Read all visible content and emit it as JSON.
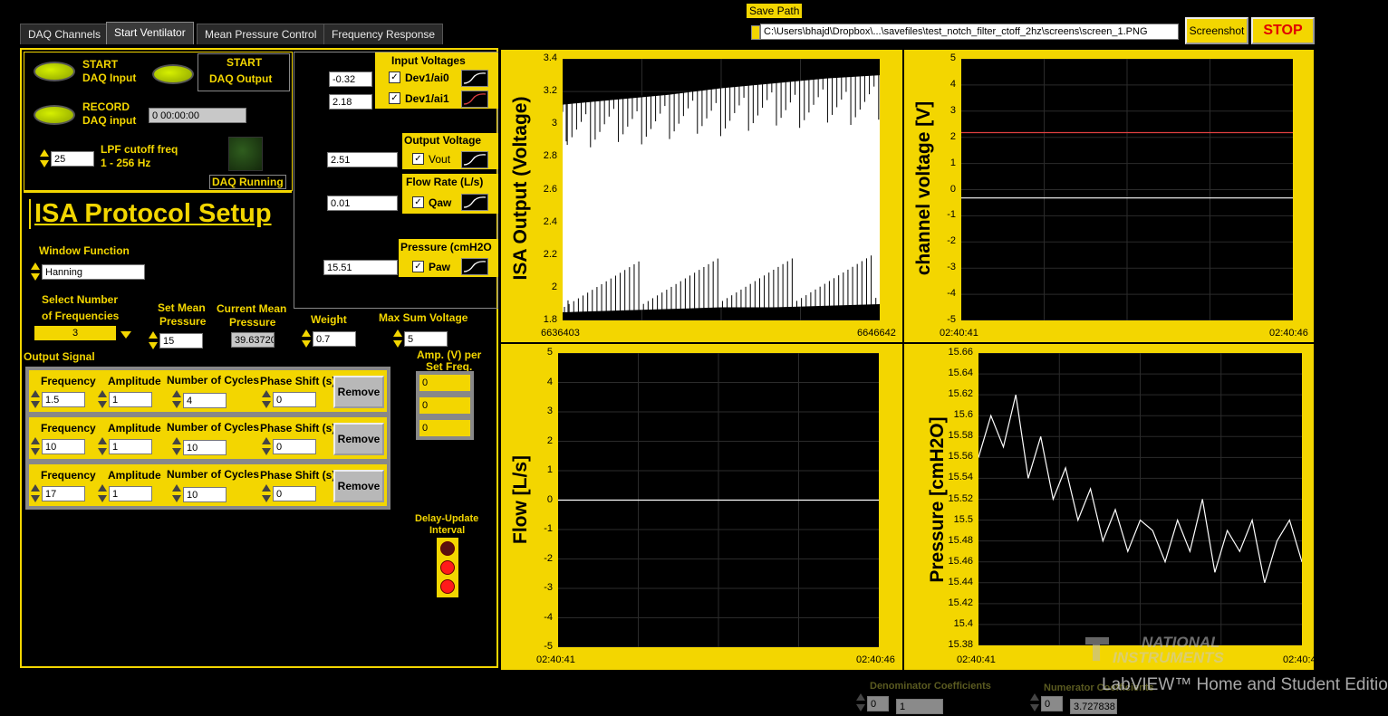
{
  "tabs": [
    "DAQ Channels",
    "Start Ventilator",
    "Mean Pressure Control",
    "Frequency Response"
  ],
  "header": {
    "save_path_label": "Save Path",
    "save_path_value": "C:\\Users\\bhajd\\Dropbox\\...\\savefiles\\test_notch_filter_ctoff_2hz\\screens\\screen_1.PNG",
    "screenshot_label": "Screenshot",
    "stop_label": "STOP"
  },
  "daq": {
    "start_input_line1": "START",
    "start_input_line2": "DAQ Input",
    "start_output_line1": "START",
    "start_output_line2": "DAQ Output",
    "record_line1": "RECORD",
    "record_line2": "DAQ input",
    "record_time": "0  00:00:00",
    "lpf_value": "25",
    "lpf_label_line1": "LPF cutoff freq",
    "lpf_label_line2": "1 - 256 Hz",
    "running_label": "DAQ Running"
  },
  "channels": {
    "input_voltages_label": "Input Voltages",
    "ai0_value": "-0.32",
    "ai0_label": "Dev1/ai0",
    "ai1_value": "2.18",
    "ai1_label": "Dev1/ai1",
    "output_voltage_label": "Output Voltage",
    "vout_value": "2.51",
    "vout_label": "Vout",
    "flow_rate_label": "Flow Rate (L/s)",
    "qaw_value": "0.01",
    "qaw_label": "Qaw",
    "pressure_label": "Pressure (cmH2O",
    "paw_value": "15.51",
    "paw_label": "Paw",
    "check_mark": "✓"
  },
  "isa": {
    "title": "ISA Protocol Setup",
    "window_function_label": "Window Function",
    "window_function_value": "Hanning",
    "select_num_line1": "Select Number",
    "select_num_line2": "of Frequencies",
    "select_num_value": "3",
    "set_mean_line1": "Set Mean",
    "set_mean_line2": "Pressure",
    "set_mean_value": "15",
    "current_mean_line1": "Current Mean",
    "current_mean_line2": "Pressure",
    "current_mean_value": "39.63720",
    "weight_label": "Weight",
    "weight_value": "0.7",
    "max_sum_label": "Max Sum Voltage",
    "max_sum_value": "5",
    "output_signal_label": "Output Signal",
    "amp_per_line1": "Amp. (V) per",
    "amp_per_line2": "Set Freq.",
    "amp_values": [
      "0",
      "0",
      "0"
    ],
    "col_frequency": "Frequency",
    "col_amplitude": "Amplitude",
    "col_cycles": "Number of Cycles",
    "col_phase": "Phase Shift (s)",
    "remove_label": "Remove",
    "rows": [
      {
        "frequency": "1.5",
        "amplitude": "1",
        "cycles": "4",
        "phase": "0"
      },
      {
        "frequency": "10",
        "amplitude": "1",
        "cycles": "10",
        "phase": "0"
      },
      {
        "frequency": "17",
        "amplitude": "1",
        "cycles": "10",
        "phase": "0"
      }
    ],
    "delay_line1": "Delay-Update",
    "delay_line2": "Interval"
  },
  "footer": {
    "denominator_label": "Denominator Coefficients",
    "denominator_index": "0",
    "denominator_value": "1",
    "numerator_label": "Numerator Coefficients",
    "numerator_index": "0",
    "numerator_value": "3.727838",
    "ni_line1": "NATIONAL",
    "ni_line2": "INSTRUMENTS",
    "labview": "LabVIEW™ Home and Student Edition"
  },
  "colors": {
    "panel_yellow": "#f3d600",
    "background": "#000000",
    "trace_white": "#ffffff",
    "trace_red": "#e04040"
  },
  "chart_data": [
    {
      "type": "line",
      "ylabel": "ISA Output (Voltage)",
      "x_start": "6636403",
      "x_end": "6646642",
      "yticks": [
        "3.4",
        "3.2",
        "3",
        "2.8",
        "2.6",
        "2.4",
        "2.2",
        "2",
        "1.8"
      ],
      "ylim": [
        1.8,
        3.4
      ],
      "series": [
        {
          "values": [
            3.12,
            3.15,
            3.18,
            3.22,
            3.25,
            3.28,
            3.3
          ]
        },
        {
          "values": [
            1.85,
            1.86,
            1.87,
            1.88,
            1.88,
            1.89,
            1.9
          ]
        }
      ]
    },
    {
      "type": "line",
      "ylabel": "channel voltage [V]",
      "x_start": "02:40:41",
      "x_end": "02:40:46",
      "yticks": [
        "5",
        "4",
        "3",
        "2",
        "1",
        "0",
        "-1",
        "-2",
        "-3",
        "-4",
        "-5"
      ],
      "ylim": [
        -5,
        5
      ],
      "series": [
        {
          "values": [
            2.18,
            2.18
          ]
        },
        {
          "values": [
            -0.32,
            -0.32
          ]
        }
      ]
    },
    {
      "type": "line",
      "ylabel": "Flow [L/s]",
      "x_start": "02:40:41",
      "x_end": "02:40:46",
      "yticks": [
        "5",
        "4",
        "3",
        "2",
        "1",
        "0",
        "-1",
        "-2",
        "-3",
        "-4",
        "-5"
      ],
      "ylim": [
        -5,
        5
      ],
      "series": [
        {
          "values": [
            0,
            0
          ]
        }
      ]
    },
    {
      "type": "line",
      "ylabel": "Pressure [cmH2O]",
      "x_start": "02:40:41",
      "x_end": "02:40:4",
      "yticks": [
        "15.66",
        "15.64",
        "15.62",
        "15.6",
        "15.58",
        "15.56",
        "15.54",
        "15.52",
        "15.5",
        "15.48",
        "15.46",
        "15.44",
        "15.42",
        "15.4",
        "15.38"
      ],
      "ylim": [
        15.38,
        15.66
      ],
      "series": [
        {
          "values": [
            15.56,
            15.6,
            15.57,
            15.62,
            15.54,
            15.58,
            15.52,
            15.55,
            15.5,
            15.53,
            15.48,
            15.51,
            15.47,
            15.5,
            15.49,
            15.46,
            15.5,
            15.47,
            15.52,
            15.45,
            15.49,
            15.47,
            15.5,
            15.44,
            15.48,
            15.5,
            15.46
          ]
        }
      ]
    }
  ]
}
